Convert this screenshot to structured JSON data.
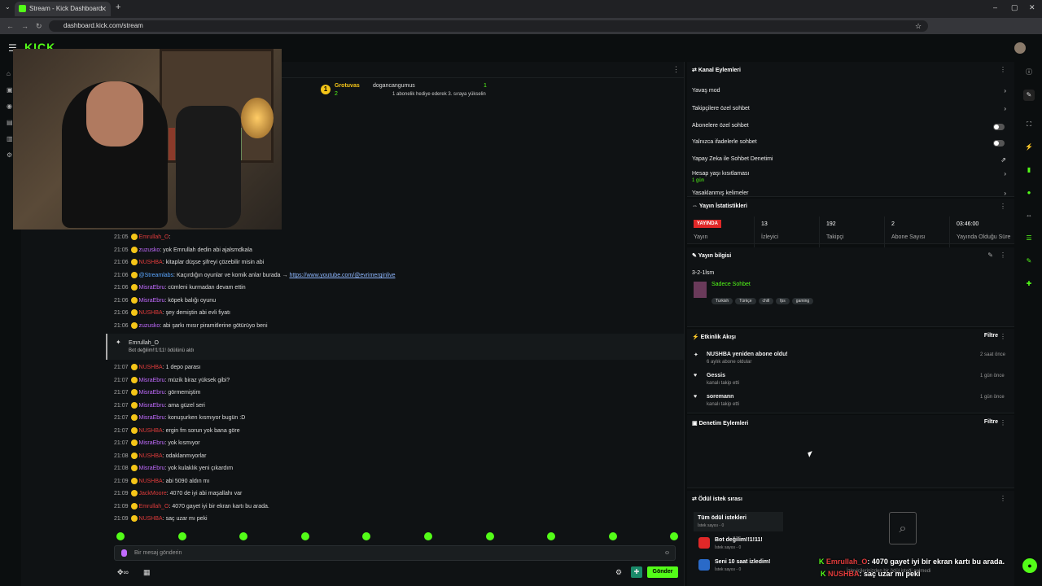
{
  "browser": {
    "tab_title": "Stream - Kick Dashboard",
    "url": "dashboard.kick.com/stream"
  },
  "app": {
    "logo": "KICK"
  },
  "pinned": {
    "rank": "1",
    "user": "Grotuvas",
    "count": "2",
    "gift_user": "dogancangumus",
    "gift_count": "1",
    "note": "1 abonelik hediye ederek 3. sıraya yükselin"
  },
  "chat": {
    "messages": [
      {
        "t": "21:05",
        "u": "Emrullah_O",
        "cls": "u-r",
        "m": ""
      },
      {
        "t": "21:05",
        "u": "zuzusko",
        "cls": "u-p",
        "m": "yok Emrullah dedin abi ajalsmdkala"
      },
      {
        "t": "21:06",
        "u": "NUSHBA",
        "cls": "u-r",
        "m": "kitaplar düşse şifreyi çözebilir misin abi"
      },
      {
        "t": "21:06",
        "u": "@Streamlabs",
        "cls": "u-b",
        "m": "Kaçırdığın oyunlar ve komik anlar burada → ",
        "link": "https://www.youtube.com/@evrimerginlive"
      },
      {
        "t": "21:06",
        "u": "MisraEbru",
        "cls": "u-p",
        "m": "cümleni kurmadan devam ettin"
      },
      {
        "t": "21:06",
        "u": "MisraEbru",
        "cls": "u-p",
        "m": "köpek balığı oyunu"
      },
      {
        "t": "21:06",
        "u": "NUSHBA",
        "cls": "u-r",
        "m": "şey demiştin abi evli fiyatı"
      },
      {
        "t": "21:06",
        "u": "zuzusko",
        "cls": "u-p",
        "m": "abi şarkı mısır piramitlerine götürüyo beni"
      },
      {
        "t": "21:07",
        "u": "NUSHBA",
        "cls": "u-r",
        "m": "1 depo parası"
      },
      {
        "t": "21:07",
        "u": "MisraEbru",
        "cls": "u-p",
        "m": "müzik biraz yüksek gibi?"
      },
      {
        "t": "21:07",
        "u": "MisraEbru",
        "cls": "u-p",
        "m": "görmemiştim"
      },
      {
        "t": "21:07",
        "u": "MisraEbru",
        "cls": "u-p",
        "m": "ama güzel seri"
      },
      {
        "t": "21:07",
        "u": "MisraEbru",
        "cls": "u-p",
        "m": "konuşurken kısmıyor bugün :D"
      },
      {
        "t": "21:07",
        "u": "NUSHBA",
        "cls": "u-r",
        "m": "ergin fm sorun yok bana göre"
      },
      {
        "t": "21:07",
        "u": "MisraEbru",
        "cls": "u-p",
        "m": "yok kısmıyor"
      },
      {
        "t": "21:08",
        "u": "NUSHBA",
        "cls": "u-r",
        "m": "odaklanmıyorlar"
      },
      {
        "t": "21:08",
        "u": "MisraEbru",
        "cls": "u-p",
        "m": "yok kulaklık yeni çıkardım"
      },
      {
        "t": "21:09",
        "u": "NUSHBA",
        "cls": "u-r",
        "m": "abi 5090 aldın mı"
      },
      {
        "t": "21:09",
        "u": "JackMoore",
        "cls": "u-r",
        "m": "4070 de iyi abi maşallahı var"
      },
      {
        "t": "21:09",
        "u": "Emrullah_O",
        "cls": "u-r",
        "m": "4070 gayet iyi bir ekran kartı bu arada."
      },
      {
        "t": "21:09",
        "u": "NUSHBA",
        "cls": "u-r",
        "m": "saç uzar mı peki"
      }
    ],
    "reward": {
      "user": "Emrullah_O",
      "text": "Bot değilim!!1!11! ödülünü aldı"
    },
    "input_placeholder": "Bir mesaj gönderin",
    "send_label": "Gönder"
  },
  "kanal": {
    "title": "Kanal Eylemleri",
    "items": [
      {
        "label": "Yavaş mod",
        "ctrl": "arrow"
      },
      {
        "label": "Takipçilere özel sohbet",
        "ctrl": "arrow"
      },
      {
        "label": "Abonelere özel sohbet",
        "ctrl": "toggle"
      },
      {
        "label": "Yalnızca ifadelerle sohbet",
        "ctrl": "toggle"
      },
      {
        "label": "Yapay Zeka ile Sohbet Denetimi",
        "ctrl": "ext"
      },
      {
        "label": "Hesap yaşı kısıtlaması",
        "sub": "1 gün",
        "ctrl": "arrow"
      },
      {
        "label": "Yasaklanmış kelimeler",
        "ctrl": "arrow"
      }
    ]
  },
  "stats": {
    "title": "Yayın İstatistikleri",
    "live": "YAYINDA",
    "live_label": "Yayın",
    "items": [
      {
        "v": "13",
        "l": "İzleyici"
      },
      {
        "v": "192",
        "l": "Takipçi"
      },
      {
        "v": "2",
        "l": "Abone Sayısı"
      },
      {
        "v": "03:46:00",
        "l": "Yayında Olduğu Süre"
      }
    ]
  },
  "info": {
    "title": "Yayın bilgisi",
    "stream_title": "3-2-1lsm",
    "category": "Sadece Sohbet",
    "tags": [
      "Turkish",
      "Türkçe",
      "chill",
      "fps",
      "gaming"
    ]
  },
  "activity": {
    "title": "Etkinlik Akışı",
    "filter": "Filtre",
    "items": [
      {
        "name": "NUSHBA yeniden abone oldu!",
        "sub": "6 aylık abone oldular",
        "time": "2 saat önce"
      },
      {
        "name": "Gessis",
        "sub": "kanalı takip etti",
        "time": "1 gün önce"
      },
      {
        "name": "soremann",
        "sub": "kanalı takip etti",
        "time": "1 gün önce"
      }
    ]
  },
  "moderation": {
    "title": "Denetim Eylemleri",
    "filter": "Filtre"
  },
  "rewards": {
    "title": "Ödül istek sırası",
    "items": [
      {
        "name": "Tüm ödül istekleri",
        "sub": "İstek sayısı - 0"
      },
      {
        "name": "Bot değilim!!1!11!",
        "sub": "İstek sayısı - 0"
      },
      {
        "name": "Seni 10 saat izledim!",
        "sub": "İstek sayısı - 0"
      }
    ],
    "empty": "İzleyicilerinizden bir ödül isteği gelmedi"
  },
  "overlay": {
    "line1_user": "Emrullah_O",
    "line1": "4070 gayet iyi bir ekran kartı bu arada.",
    "line2_user": "NUSHBA",
    "line2": "saç uzar mı peki"
  }
}
